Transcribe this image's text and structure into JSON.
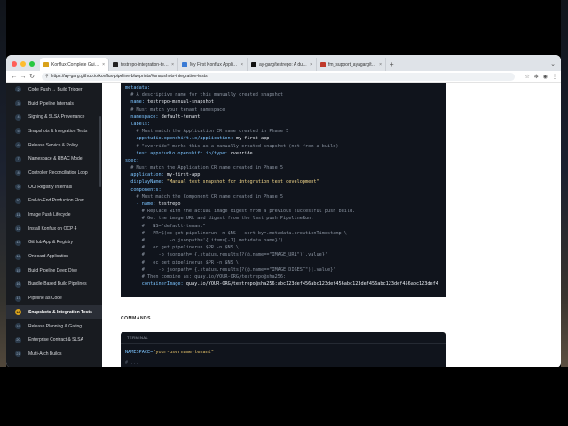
{
  "tabs": [
    {
      "title": "Konflux Complete Guide — I",
      "color": "#d9a21b",
      "active": true
    },
    {
      "title": "testrepo-integration-tests",
      "color": "#222222",
      "active": false
    },
    {
      "title": "My First Konflux Application",
      "color": "#3a7bd5",
      "active": false
    },
    {
      "title": "ay-garg/testrepo: A dummy",
      "color": "#111111",
      "active": false
    },
    {
      "title": "fm_support_ayagarg/testrep",
      "color": "#c0392b",
      "active": false
    }
  ],
  "address_bar": {
    "url": "https://ay-garg.github.io/konflux-pipeline-blueprints/#snapshots-integration-tests"
  },
  "sidebar": {
    "items": [
      {
        "num": "2",
        "label": "Code Push → Build Trigger"
      },
      {
        "num": "3",
        "label": "Build Pipeline Internals"
      },
      {
        "num": "4",
        "label": "Signing & SLSA Provenance"
      },
      {
        "num": "5",
        "label": "Snapshots & Integration Tests"
      },
      {
        "num": "6",
        "label": "Release Service & Policy"
      },
      {
        "num": "7",
        "label": "Namespace & RBAC Model"
      },
      {
        "num": "8",
        "label": "Controller Reconciliation Loop"
      },
      {
        "num": "9",
        "label": "OCI Registry Internals"
      },
      {
        "num": "10",
        "label": "End-to-End Production Flow"
      },
      {
        "num": "11",
        "label": "Image Push Lifecycle"
      },
      {
        "num": "12",
        "label": "Install Konflux on OCP 4"
      },
      {
        "num": "13",
        "label": "GitHub App & Registry"
      },
      {
        "num": "14",
        "label": "Onboard Application"
      },
      {
        "num": "15",
        "label": "Build Pipeline Deep Dive"
      },
      {
        "num": "16",
        "label": "Bundle-Based Build Pipelines"
      },
      {
        "num": "17",
        "label": "Pipeline as Code"
      },
      {
        "num": "18",
        "label": "Snapshots & Integration Tests",
        "active": true
      },
      {
        "num": "19",
        "label": "Release Planning & Gating"
      },
      {
        "num": "20",
        "label": "Enterprise Contract & SLSA"
      },
      {
        "num": "21",
        "label": "Multi-Arch Builds"
      }
    ]
  },
  "code_lines": [
    [
      {
        "t": "metadata:",
        "c": "k"
      }
    ],
    [
      {
        "t": "  # A descriptive name for this manually created snapshot",
        "c": "c"
      }
    ],
    [
      {
        "t": "  name: ",
        "c": "k"
      },
      {
        "t": "testrepo-manual-snapshot",
        "c": "w"
      }
    ],
    [
      {
        "t": "  # Must match your tenant namespace",
        "c": "c"
      }
    ],
    [
      {
        "t": "  namespace: ",
        "c": "k"
      },
      {
        "t": "default-tenant",
        "c": "w"
      }
    ],
    [
      {
        "t": "  labels:",
        "c": "k"
      }
    ],
    [
      {
        "t": "    # Must match the Application CR name created in Phase 5",
        "c": "c"
      }
    ],
    [
      {
        "t": "    appstudio.openshift.io/application: ",
        "c": "k"
      },
      {
        "t": "my-first-app",
        "c": "w"
      }
    ],
    [
      {
        "t": "    # \"override\" marks this as a manually created snapshot (not from a build)",
        "c": "c"
      }
    ],
    [
      {
        "t": "    test.appstudio.openshift.io/type: ",
        "c": "k"
      },
      {
        "t": "override",
        "c": "w"
      }
    ],
    [
      {
        "t": "spec:",
        "c": "k"
      }
    ],
    [
      {
        "t": "  # Must match the Application CR name created in Phase 5",
        "c": "c"
      }
    ],
    [
      {
        "t": "  application: ",
        "c": "k"
      },
      {
        "t": "my-first-app",
        "c": "w"
      }
    ],
    [
      {
        "t": "  displayName: ",
        "c": "k"
      },
      {
        "t": "\"Manual test snapshot for integration test development\"",
        "c": "s"
      }
    ],
    [
      {
        "t": "  components:",
        "c": "k"
      }
    ],
    [
      {
        "t": "    # Must match the Component CR name created in Phase 5",
        "c": "c"
      }
    ],
    [
      {
        "t": "    - name: ",
        "c": "k"
      },
      {
        "t": "testrepo",
        "c": "w"
      }
    ],
    [
      {
        "t": "      # Replace with the actual image digest from a previous successful push build.",
        "c": "c"
      }
    ],
    [
      {
        "t": "      # Get the image URL and digest from the last push PipelineRun:",
        "c": "c"
      }
    ],
    [
      {
        "t": "      #   NS=\"default-tenant\"",
        "c": "c"
      }
    ],
    [
      {
        "t": "      #   PR=$(oc get pipelinerun -n $NS --sort-by=.metadata.creationTimestamp \\",
        "c": "c"
      }
    ],
    [
      {
        "t": "      #         -o jsonpath='{.items[-1].metadata.name}')",
        "c": "c"
      }
    ],
    [
      {
        "t": "      #   oc get pipelinerun $PR -n $NS \\",
        "c": "c"
      }
    ],
    [
      {
        "t": "      #     -o jsonpath='{.status.results[?(@.name==\"IMAGE_URL\")].value}'",
        "c": "c"
      }
    ],
    [
      {
        "t": "      #   oc get pipelinerun $PR -n $NS \\",
        "c": "c"
      }
    ],
    [
      {
        "t": "      #     -o jsonpath='{.status.results[?(@.name==\"IMAGE_DIGEST\")].value}'",
        "c": "c"
      }
    ],
    [
      {
        "t": "      # Then combine as: quay.io/YOUR-ORG/testrepo@sha256:",
        "c": "c"
      }
    ],
    [
      {
        "t": "      containerImage: ",
        "c": "k"
      },
      {
        "t": "quay.io/YOUR-ORG/testrepo@sha256:abc123def456abc123def456abc123def456abc123def456abc123def4",
        "c": "w"
      }
    ]
  ],
  "commands_section": {
    "title": "COMMANDS"
  },
  "terminal": {
    "header": "TERMINAL",
    "line_key": "NAMESPACE=",
    "line_value": "\"your-username-tenant\"",
    "faded": "# ..."
  }
}
